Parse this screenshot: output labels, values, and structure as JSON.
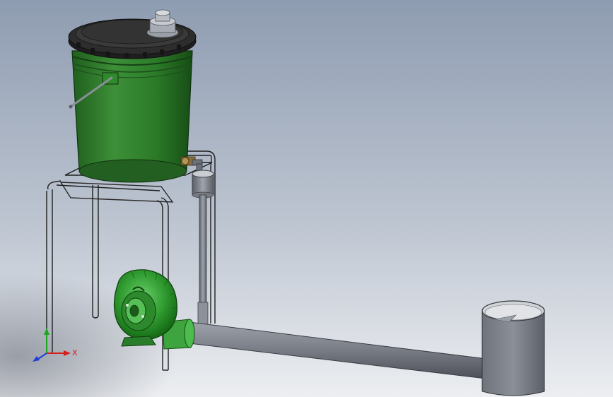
{
  "viewport": {
    "background_top": "#8e9cb1",
    "background_bottom": "#e9ebee"
  },
  "model": {
    "bucket_color": "#2e7d2b",
    "lid_color": "#2b2b2b",
    "blower_color": "#3aa33a",
    "frame_color": "#1f1f1f",
    "pipe_color": "#7d8089"
  },
  "triad": {
    "x_label": "X",
    "x_color": "#d62020",
    "y_color": "#1fa51f",
    "z_color": "#1f3fd6"
  }
}
